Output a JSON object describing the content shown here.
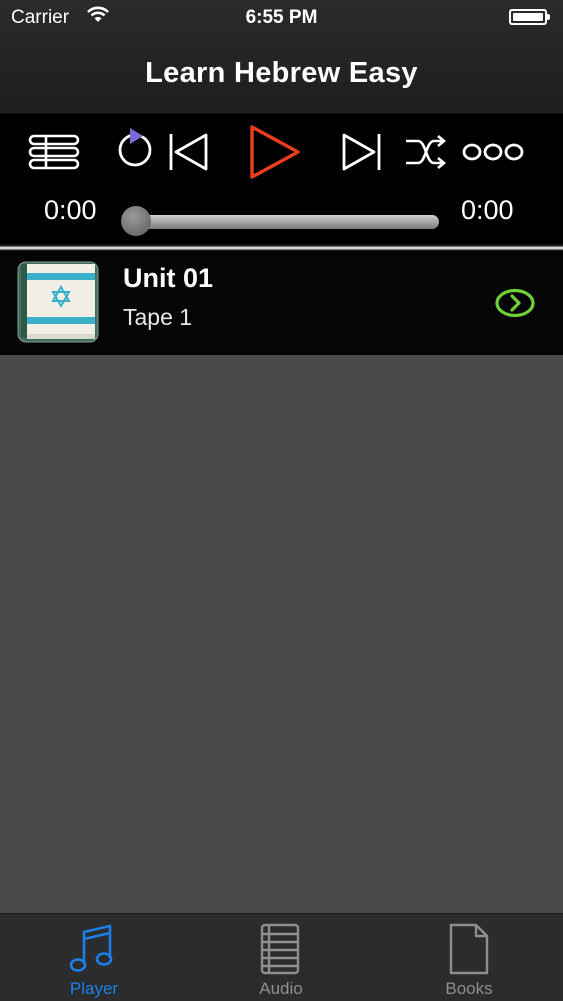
{
  "status_bar": {
    "carrier": "Carrier",
    "time": "6:55 PM"
  },
  "nav": {
    "title": "Learn Hebrew Easy"
  },
  "player": {
    "elapsed": "0:00",
    "remaining": "0:00",
    "progress": 0,
    "accent_color": "#e8401f"
  },
  "list": {
    "items": [
      {
        "title": "Unit 01",
        "subtitle": "Tape 1",
        "chevron_color": "#6fcf3a"
      }
    ]
  },
  "tabbar": {
    "tabs": [
      {
        "label": "Player",
        "icon": "music-note-icon",
        "active": true
      },
      {
        "label": "Audio",
        "icon": "list-icon",
        "active": false
      },
      {
        "label": "Books",
        "icon": "document-icon",
        "active": false
      }
    ],
    "active_color": "#1a80e8"
  }
}
